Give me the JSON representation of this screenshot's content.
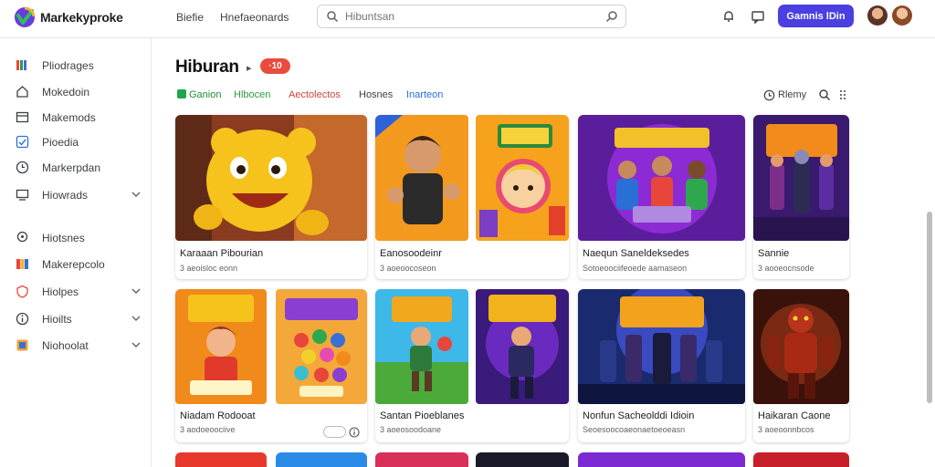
{
  "header": {
    "brand": "Markekyproke",
    "nav": [
      "Biefie",
      "Hnefaeonards"
    ],
    "search_placeholder": "Hibuntsan",
    "cta_label": "Gamnis lDin",
    "accent": "#4a3fe0"
  },
  "sidebar": {
    "items": [
      {
        "label": "Pliodrages",
        "icon": "stacked-cards-icon",
        "chevron": false
      },
      {
        "label": "Mokedoin",
        "icon": "home-icon",
        "chevron": false
      },
      {
        "label": "Makemods",
        "icon": "folder-icon",
        "chevron": false
      },
      {
        "label": "Pioedia",
        "icon": "check-icon",
        "chevron": false
      },
      {
        "label": "Markerpdan",
        "icon": "clock-icon",
        "chevron": false
      },
      {
        "label": "Hiowrads",
        "icon": "monitor-icon",
        "chevron": true
      },
      {
        "label": "Hiotsnes",
        "icon": "pin-icon",
        "chevron": false
      },
      {
        "label": "Makerepcolo",
        "icon": "palette-icon",
        "chevron": false
      },
      {
        "label": "Hiolpes",
        "icon": "shield-icon",
        "chevron": true
      },
      {
        "label": "Hioilts",
        "icon": "info-icon",
        "chevron": true
      },
      {
        "label": "Niohoolat",
        "icon": "star-icon",
        "chevron": true
      }
    ]
  },
  "main": {
    "title": "Hiburan",
    "title_badge": "·10",
    "filters": [
      {
        "label": "Ganion",
        "color": "#1f8f3a"
      },
      {
        "label": "Hlbocen",
        "color": "#2e9b3d"
      },
      {
        "label": "Aectolectos",
        "color": "#d0463c"
      },
      {
        "label": "Hosnes",
        "color": "#3c4043"
      },
      {
        "label": "Inarteon",
        "color": "#2a6fd6"
      }
    ],
    "sort_label": "Rlemy",
    "cards": [
      {
        "title": "Karaaan Pibourian",
        "meta": "3 aeoisloc eonn"
      },
      {
        "title": "Eanosoodeinr",
        "meta": "3 aoeoocoseon"
      },
      {
        "title": "Naequn Saneldeksedes",
        "meta": "Sotoeoociifeoede aamaseon"
      },
      {
        "title": "Sannie",
        "meta": "3 aooeocnsode"
      },
      {
        "title": "Niadam Rodooat",
        "meta": "3 aodoeoociive",
        "chip": "ⓘ"
      },
      {
        "title": "Santan Pioeblanes",
        "meta": "3 aoeosoodoane"
      },
      {
        "title": "Nonfun Sacheolddi Idioin",
        "meta": "Seoesoocoaeonaetoeoeasn"
      },
      {
        "title": "Haikaran Caone",
        "meta": "3 aoeoonnbcos"
      }
    ]
  }
}
